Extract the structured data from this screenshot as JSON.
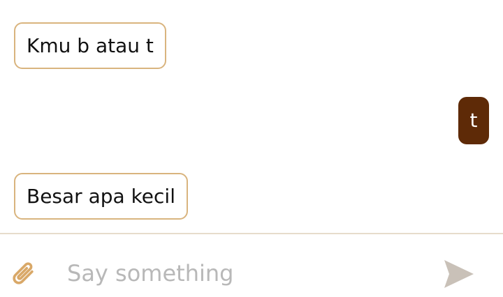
{
  "colors": {
    "incoming_border": "#d9b47e",
    "outgoing_background": "#5e2a07",
    "attach_icon": "#d9a868",
    "send_icon": "#c9c1b8",
    "placeholder": "#b8b8b8",
    "divider": "#e6dccb"
  },
  "messages": [
    {
      "direction": "incoming",
      "text": "Kmu b atau t"
    },
    {
      "direction": "outgoing",
      "text": "t"
    },
    {
      "direction": "incoming",
      "text": "Besar apa kecil"
    }
  ],
  "composer": {
    "attach_icon": "paperclip-icon",
    "input_value": "",
    "input_placeholder": "Say something",
    "send_icon": "send-icon"
  }
}
